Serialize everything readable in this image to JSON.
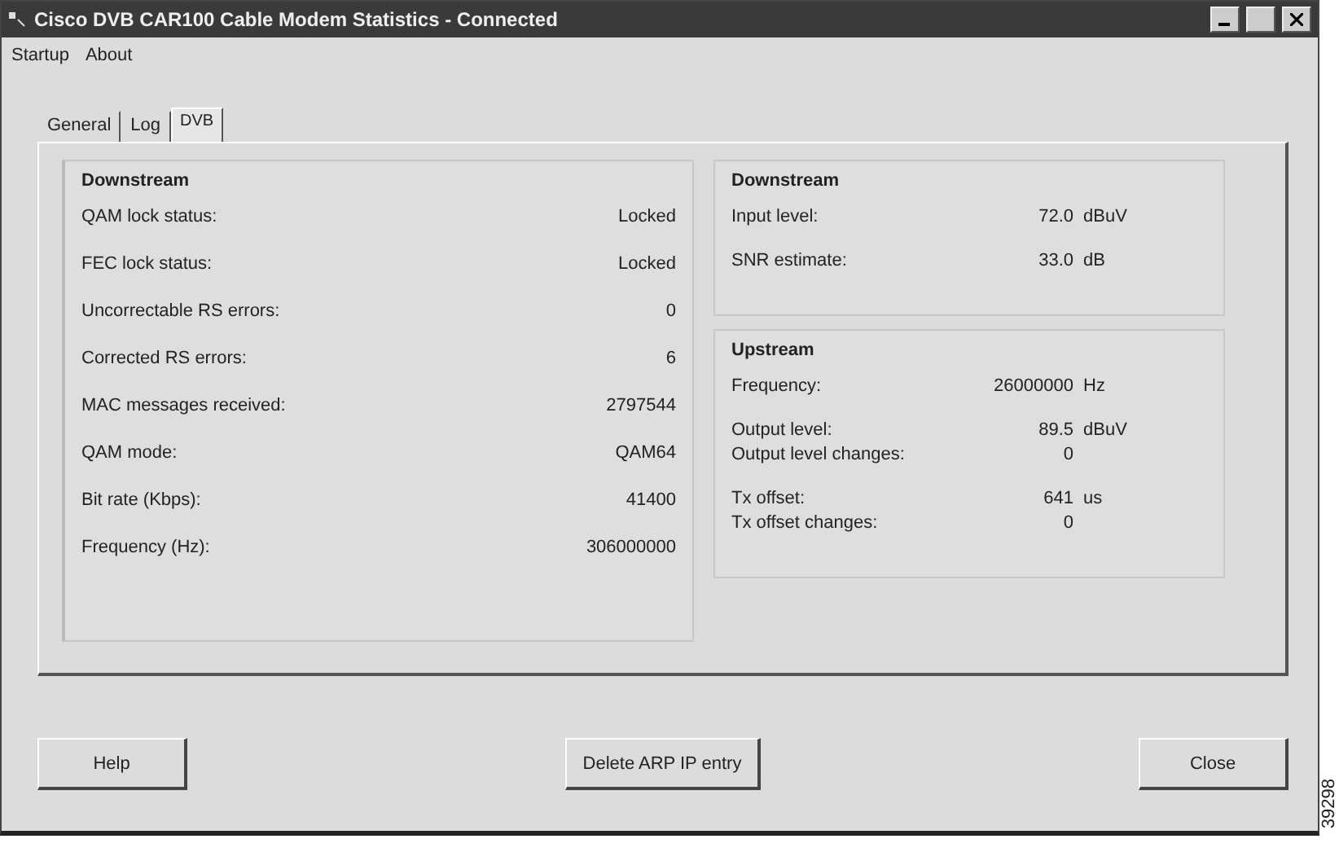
{
  "window": {
    "title": "Cisco DVB CAR100 Cable Modem Statistics - Connected"
  },
  "menu": [
    "Startup",
    "About"
  ],
  "tabs": [
    {
      "label": "General",
      "selected": false
    },
    {
      "label": "Log",
      "selected": false
    },
    {
      "label": "DVB",
      "selected": true
    }
  ],
  "left_group": {
    "title": "Downstream",
    "rows": [
      {
        "label": "QAM lock status:",
        "value": "Locked"
      },
      {
        "label": "FEC lock status:",
        "value": "Locked"
      },
      {
        "label": "Uncorrectable RS errors:",
        "value": "0"
      },
      {
        "label": "Corrected RS errors:",
        "value": "6"
      },
      {
        "label": "MAC messages received:",
        "value": "2797544"
      },
      {
        "label": "QAM mode:",
        "value": "QAM64"
      },
      {
        "label": "Bit rate (Kbps):",
        "value": "41400"
      },
      {
        "label": "Frequency (Hz):",
        "value": "306000000"
      }
    ]
  },
  "right_groups": [
    {
      "title": "Downstream",
      "clusters": [
        [
          {
            "label": "Input level:",
            "value": "72.0",
            "unit": "dBuV"
          }
        ],
        [
          {
            "label": "SNR estimate:",
            "value": "33.0",
            "unit": "dB"
          }
        ]
      ]
    },
    {
      "title": "Upstream",
      "clusters": [
        [
          {
            "label": "Frequency:",
            "value": "26000000",
            "unit": "Hz"
          }
        ],
        [
          {
            "label": "Output level:",
            "value": "89.5",
            "unit": "dBuV"
          },
          {
            "label": "Output level changes:",
            "value": "0"
          }
        ],
        [
          {
            "label": "Tx offset:",
            "value": "641",
            "unit": "us"
          },
          {
            "label": "Tx offset changes:",
            "value": "0"
          }
        ]
      ]
    }
  ],
  "buttons": [
    "Help",
    "Delete ARP IP entry",
    "Close"
  ],
  "figure_id": "39298"
}
